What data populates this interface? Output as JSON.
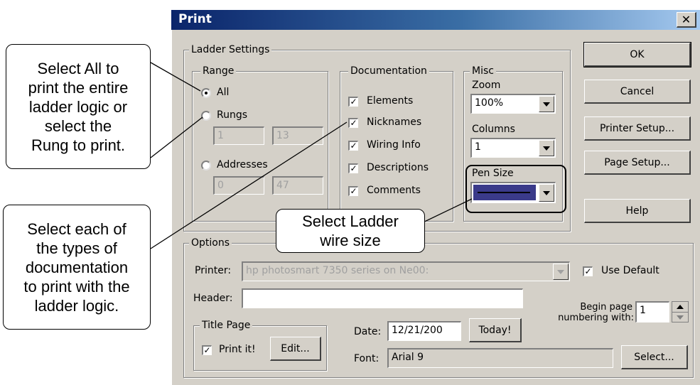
{
  "dialog": {
    "title": "Print",
    "close_glyph": "✕",
    "buttons": {
      "ok": "OK",
      "cancel": "Cancel",
      "printer_setup": "Printer Setup...",
      "page_setup": "Page Setup...",
      "help": "Help"
    },
    "ladder_settings": {
      "label": "Ladder Settings",
      "range": {
        "label": "Range",
        "all": "All",
        "rungs": "Rungs",
        "rungs_from": "1",
        "rungs_to": "13",
        "addresses": "Addresses",
        "addr_from": "0",
        "addr_to": "47",
        "selected": "All"
      },
      "documentation": {
        "label": "Documentation",
        "items": [
          "Elements",
          "Nicknames",
          "Wiring Info",
          "Descriptions",
          "Comments"
        ]
      },
      "misc": {
        "label": "Misc",
        "zoom_label": "Zoom",
        "zoom_value": "100%",
        "columns_label": "Columns",
        "columns_value": "1",
        "pen_label": "Pen Size"
      }
    },
    "options": {
      "label": "Options",
      "printer_label": "Printer:",
      "printer_value": "hp photosmart 7350 series on Ne00:",
      "use_default": "Use Default",
      "header_label": "Header:",
      "header_value": "",
      "title_page_label": "Title Page",
      "print_it": "Print it!",
      "edit": "Edit...",
      "date_label": "Date:",
      "date_value": "12/21/200",
      "today": "Today!",
      "begin_page_1": "Begin page",
      "begin_page_2": "numbering with:",
      "begin_page_value": "1",
      "font_label": "Font:",
      "font_value": "Arial 9",
      "select": "Select..."
    }
  },
  "callouts": {
    "all": [
      "Select All to",
      "print the entire",
      "ladder logic or",
      "select the",
      "Rung to print."
    ],
    "doc": [
      "Select each of",
      "the types of",
      "documentation",
      "to print with the",
      "ladder logic."
    ],
    "wire": [
      "Select Ladder",
      "wire size"
    ]
  },
  "colors": {
    "pen_color": "#3a3a8a",
    "title_gradient_start": "#0a246a"
  }
}
